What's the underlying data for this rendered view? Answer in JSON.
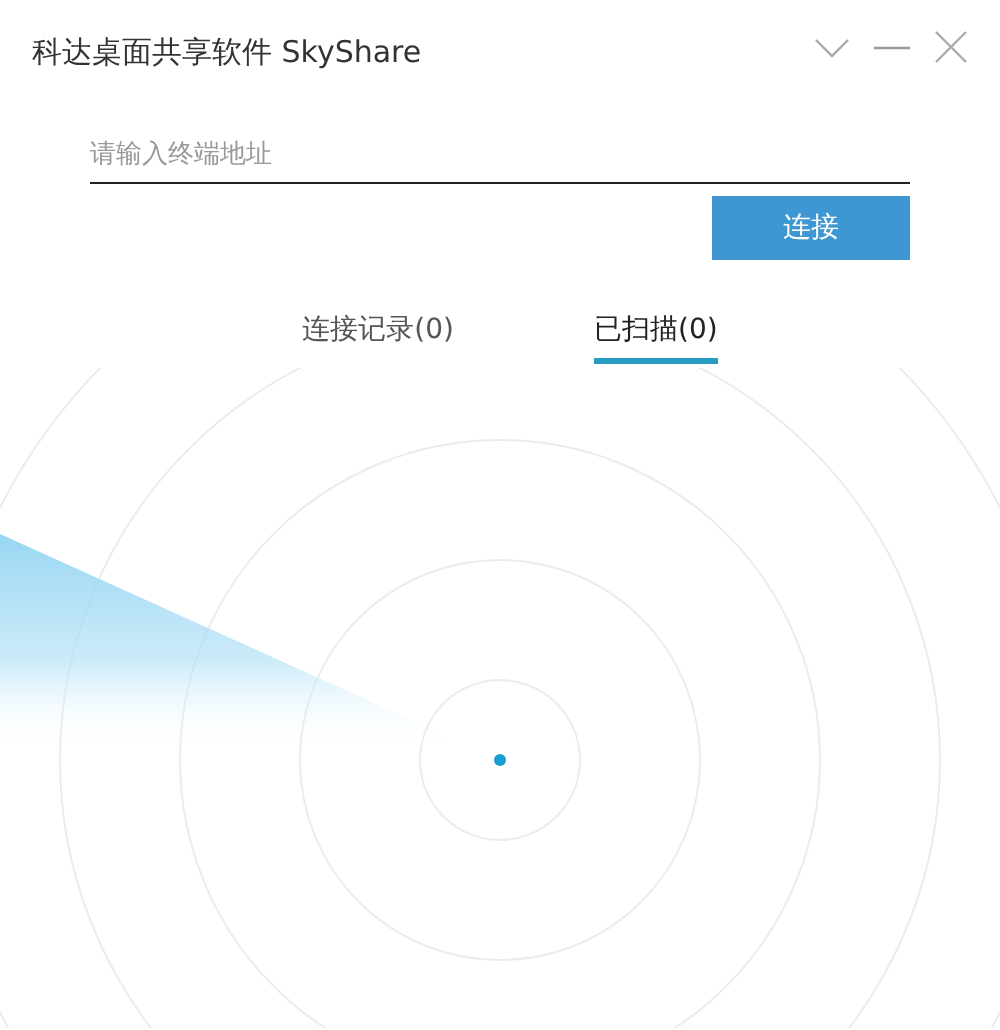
{
  "window": {
    "title": "科达桌面共享软件 SkyShare"
  },
  "address_field": {
    "placeholder": "请输入终端地址"
  },
  "connect_button": {
    "label": "连接"
  },
  "tabs": [
    {
      "label": "连接记录(0)",
      "selected": false
    },
    {
      "label": "已扫描(0)",
      "selected": true
    }
  ]
}
